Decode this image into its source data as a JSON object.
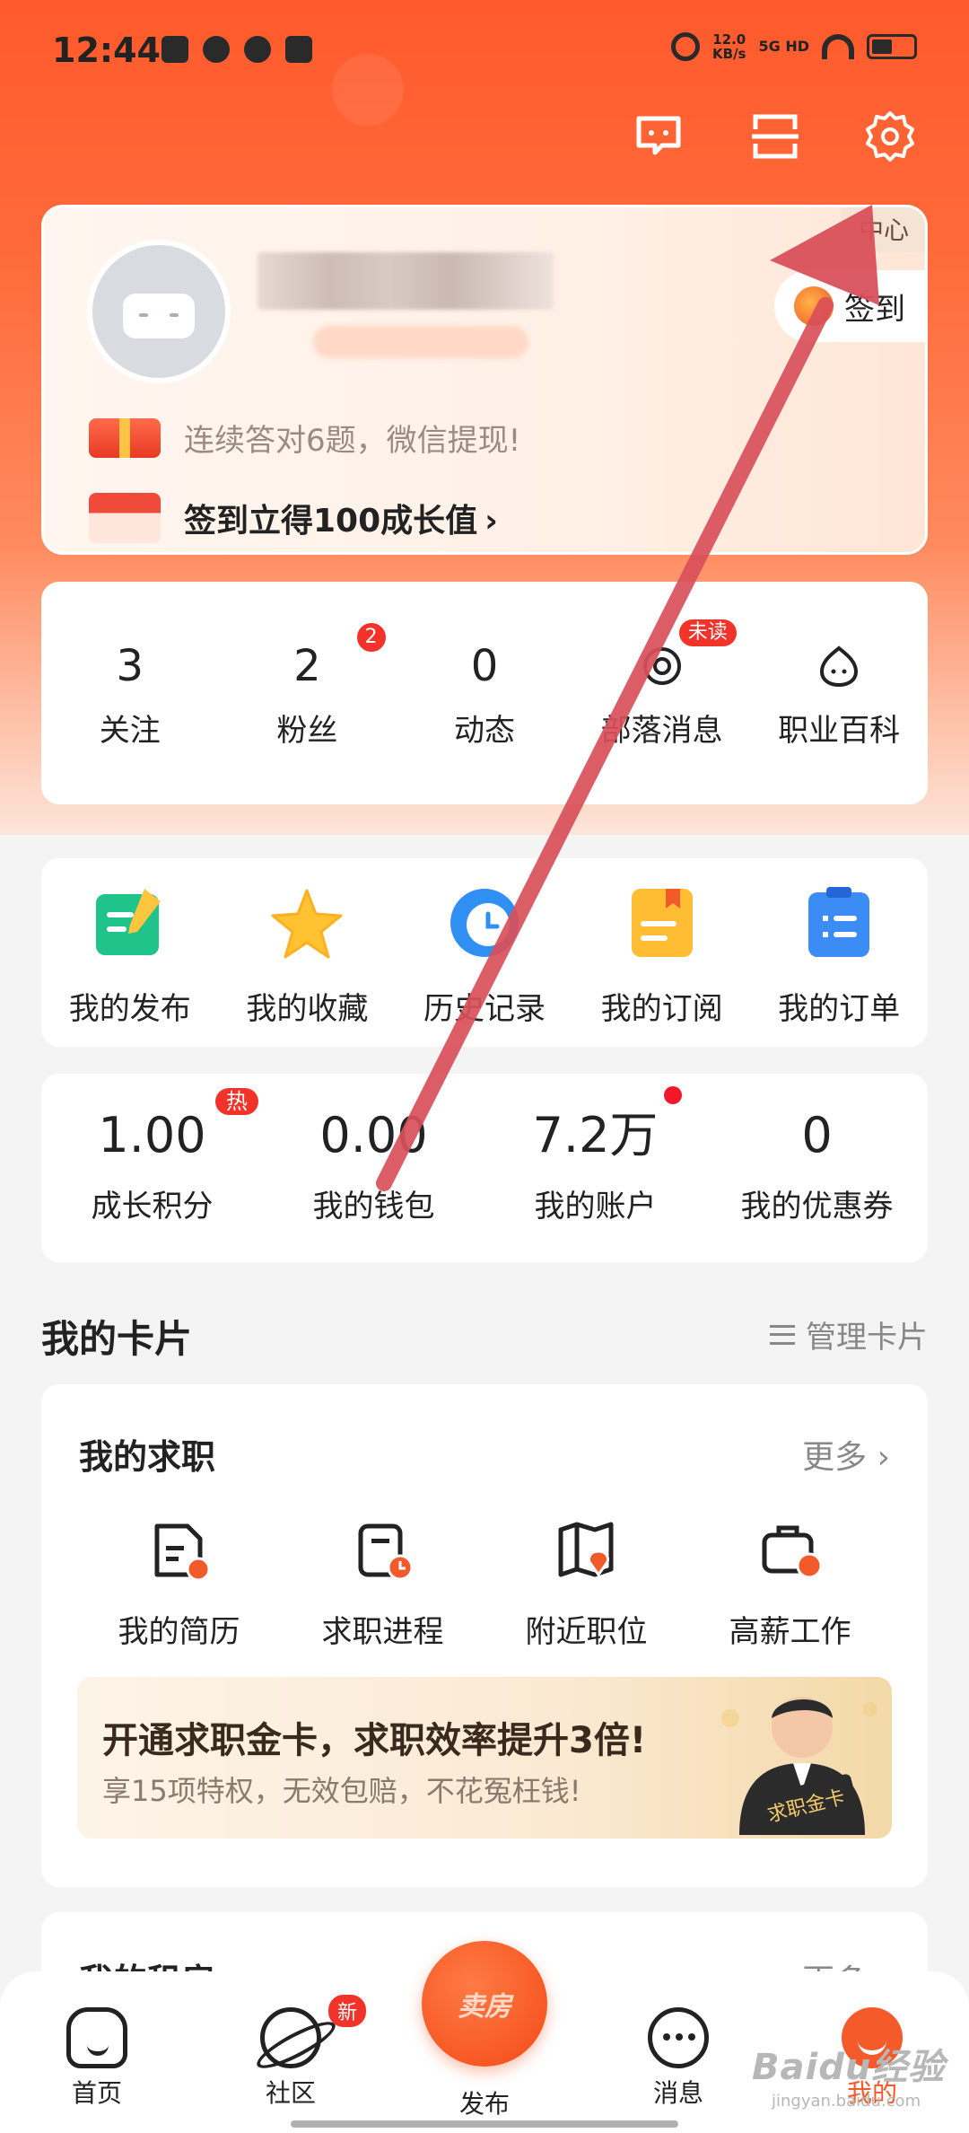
{
  "status_bar": {
    "time": "12:44",
    "speed": "12.0",
    "speed_unit": "KB/s",
    "network": "5G HD"
  },
  "header": {
    "service_icon": "headset-icon",
    "scan_icon": "scan-icon",
    "settings_icon": "gear-icon"
  },
  "profile": {
    "member_center": "中心",
    "signin_label": "签到",
    "promo_quiz": "连续答对6题，微信提现!",
    "promo_signin": "签到立得100成长值"
  },
  "stats": [
    {
      "value": "3",
      "label": "关注"
    },
    {
      "value": "2",
      "label": "粉丝",
      "badge": "2"
    },
    {
      "value": "0",
      "label": "动态"
    },
    {
      "label": "部落消息",
      "badge": "未读"
    },
    {
      "label": "职业百科"
    }
  ],
  "features": [
    {
      "label": "我的发布",
      "icon": "publish-icon"
    },
    {
      "label": "我的收藏",
      "icon": "star-icon"
    },
    {
      "label": "历史记录",
      "icon": "history-icon"
    },
    {
      "label": "我的订阅",
      "icon": "subscription-icon"
    },
    {
      "label": "我的订单",
      "icon": "order-icon"
    }
  ],
  "wallet": [
    {
      "value": "1.00",
      "label": "成长积分",
      "badge": "热"
    },
    {
      "value": "0.00",
      "label": "我的钱包"
    },
    {
      "value": "7.2万",
      "label": "我的账户"
    },
    {
      "value": "0",
      "label": "我的优惠券"
    }
  ],
  "cards_section": {
    "title": "我的卡片",
    "manage": "管理卡片"
  },
  "job_card": {
    "title": "我的求职",
    "more": "更多 ›",
    "items": [
      {
        "label": "我的简历",
        "icon": "resume-icon"
      },
      {
        "label": "求职进程",
        "icon": "progress-icon"
      },
      {
        "label": "附近职位",
        "icon": "map-pin-icon"
      },
      {
        "label": "高薪工作",
        "icon": "briefcase-icon"
      }
    ],
    "banner_title": "开通求职金卡，求职效率提升3倍!",
    "banner_sub": "享15项特权，无效包赔，不花冤枉钱!",
    "banner_card_label": "求职金卡"
  },
  "rent_card": {
    "title": "我的租房",
    "more": "更多 ›"
  },
  "bottom_nav": [
    {
      "label": "首页",
      "icon": "home-icon"
    },
    {
      "label": "社区",
      "icon": "planet-icon",
      "badge": "新"
    },
    {
      "label": "发布",
      "icon": "publish-button",
      "center_text": "卖房"
    },
    {
      "label": "消息",
      "icon": "message-icon"
    },
    {
      "label": "我的",
      "icon": "mine-icon"
    }
  ],
  "watermark": {
    "text": "Baidu经验",
    "sub": "jingyan.baidu.com"
  },
  "colors": {
    "brand": "#ff5a2c",
    "badge": "#f2332a",
    "annotation_arrow": "#d9505a"
  }
}
